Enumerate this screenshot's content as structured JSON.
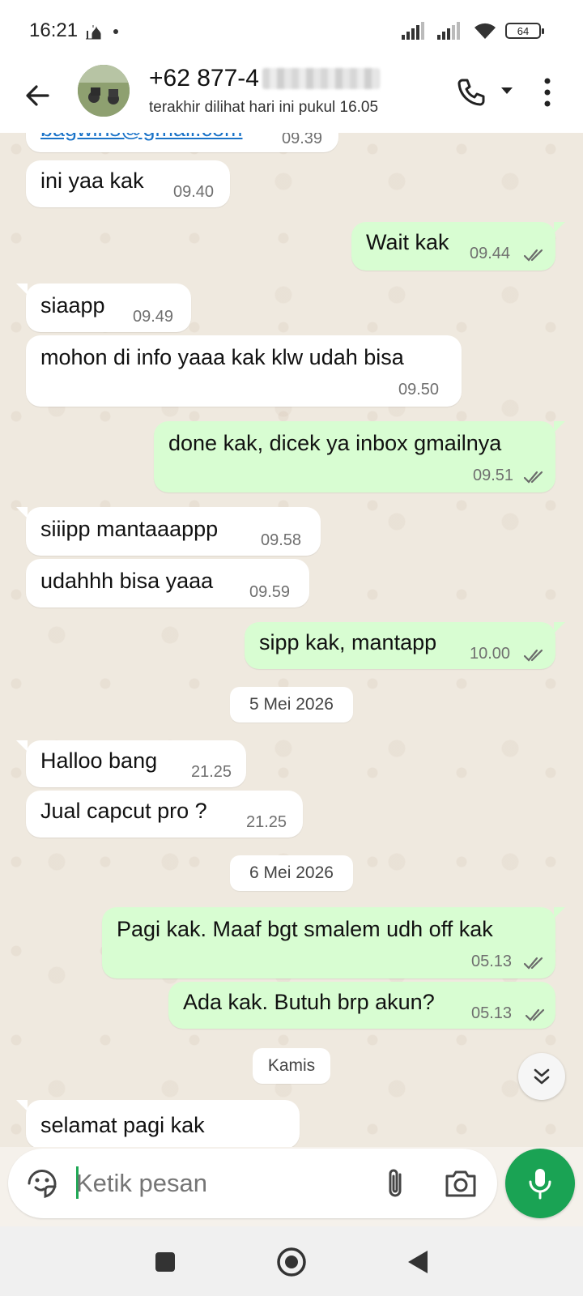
{
  "status_bar": {
    "time": "16:21",
    "battery": "64",
    "icons": [
      "mosque-icon",
      "dot-icon",
      "signal-icon",
      "signal-icon",
      "wifi-icon",
      "battery-icon"
    ]
  },
  "header": {
    "contact_number": "+62 877-4",
    "last_seen": "terakhir dilihat hari ini pukul 16.05",
    "icons": [
      "back-arrow-icon",
      "phone-icon",
      "caret-down-icon",
      "more-vert-icon"
    ]
  },
  "messages": [
    {
      "direction": "in",
      "text": "bagwins@gmail.com",
      "time": "09.39"
    },
    {
      "direction": "in",
      "text": "ini yaa kak",
      "time": "09.40"
    },
    {
      "direction": "out",
      "text": "Wait kak",
      "time": "09.44",
      "read": true
    },
    {
      "direction": "in",
      "text": "siaapp",
      "time": "09.49"
    },
    {
      "direction": "in",
      "text": "mohon di info yaaa kak klw udah bisa",
      "time": "09.50"
    },
    {
      "direction": "out",
      "text": "done kak, dicek ya inbox gmailnya",
      "time": "09.51",
      "read": true
    },
    {
      "direction": "in",
      "text": "siiipp mantaaappp",
      "time": "09.58"
    },
    {
      "direction": "in",
      "text": "udahhh bisa yaaa",
      "time": "09.59"
    },
    {
      "direction": "out",
      "text": "sipp kak, mantapp",
      "time": "10.00",
      "read": true
    },
    {
      "direction": "in",
      "text": "Halloo bang",
      "time": "21.25"
    },
    {
      "direction": "in",
      "text": "Jual capcut pro ?",
      "time": "21.25"
    },
    {
      "direction": "out",
      "text": "Pagi kak. Maaf bgt smalem udh off kak",
      "time": "05.13",
      "read": true
    },
    {
      "direction": "out",
      "text": "Ada kak. Butuh brp akun?",
      "time": "05.13",
      "read": true
    },
    {
      "direction": "in",
      "text": "selamat pagi kak",
      "time": ""
    }
  ],
  "date_chips": [
    "5 Mei 2026",
    "6 Mei 2026",
    "Kamis"
  ],
  "composer": {
    "placeholder": "Ketik pesan",
    "icons": [
      "sticker-icon",
      "paperclip-icon",
      "camera-icon",
      "mic-icon"
    ]
  },
  "nav_bar": {
    "icons": [
      "recents-square-icon",
      "home-circle-icon",
      "back-triangle-icon"
    ]
  },
  "colors": {
    "outgoing_bubble": "#d8fdd2",
    "incoming_bubble": "#ffffff",
    "accent_green": "#1aa354",
    "chat_background": "#efe9df"
  }
}
